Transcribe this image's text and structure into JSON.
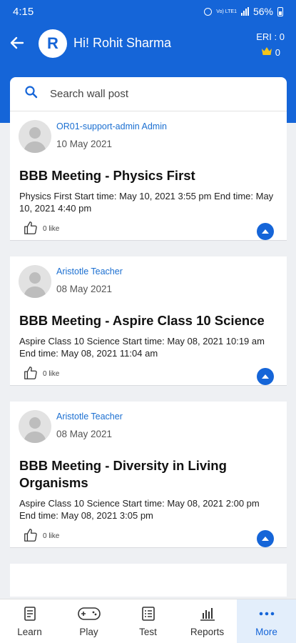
{
  "status": {
    "time": "4:15",
    "battery": "56%",
    "volte": "Vo) LTE1"
  },
  "header": {
    "avatar_letter": "R",
    "greeting": "Hi! Rohit Sharma",
    "eri_label": "ERI : 0",
    "crown_count": "0"
  },
  "search": {
    "placeholder": "Search wall post"
  },
  "posts": [
    {
      "author": "OR01-support-admin Admin",
      "date": "10 May 2021",
      "title": "BBB Meeting - Physics First",
      "body": "Physics First Start time: May 10, 2021 3:55 pm End time: May 10, 2021 4:40 pm",
      "likes": "0 like"
    },
    {
      "author": "Aristotle Teacher",
      "date": "08 May 2021",
      "title": "BBB Meeting - Aspire Class 10 Science",
      "body": "Aspire Class 10 Science Start time: May 08, 2021 10:19 am End time: May 08, 2021 11:04 am",
      "likes": "0 like"
    },
    {
      "author": "Aristotle Teacher",
      "date": "08 May 2021",
      "title": "BBB Meeting - Diversity in Living Organisms",
      "body": "Aspire Class 10 Science Start time: May 08, 2021 2:00 pm End time: May 08, 2021 3:05 pm",
      "likes": "0 like"
    }
  ],
  "nav": [
    {
      "label": "Learn",
      "icon": "book-icon"
    },
    {
      "label": "Play",
      "icon": "gamepad-icon"
    },
    {
      "label": "Test",
      "icon": "test-sheet-icon"
    },
    {
      "label": "Reports",
      "icon": "bar-chart-icon"
    },
    {
      "label": "More",
      "icon": "more-dots-icon",
      "active": true
    }
  ],
  "colors": {
    "primary": "#1565d8",
    "link": "#1b6fd1",
    "crown": "#f5c518",
    "active_nav_bg": "#e3eefb"
  }
}
